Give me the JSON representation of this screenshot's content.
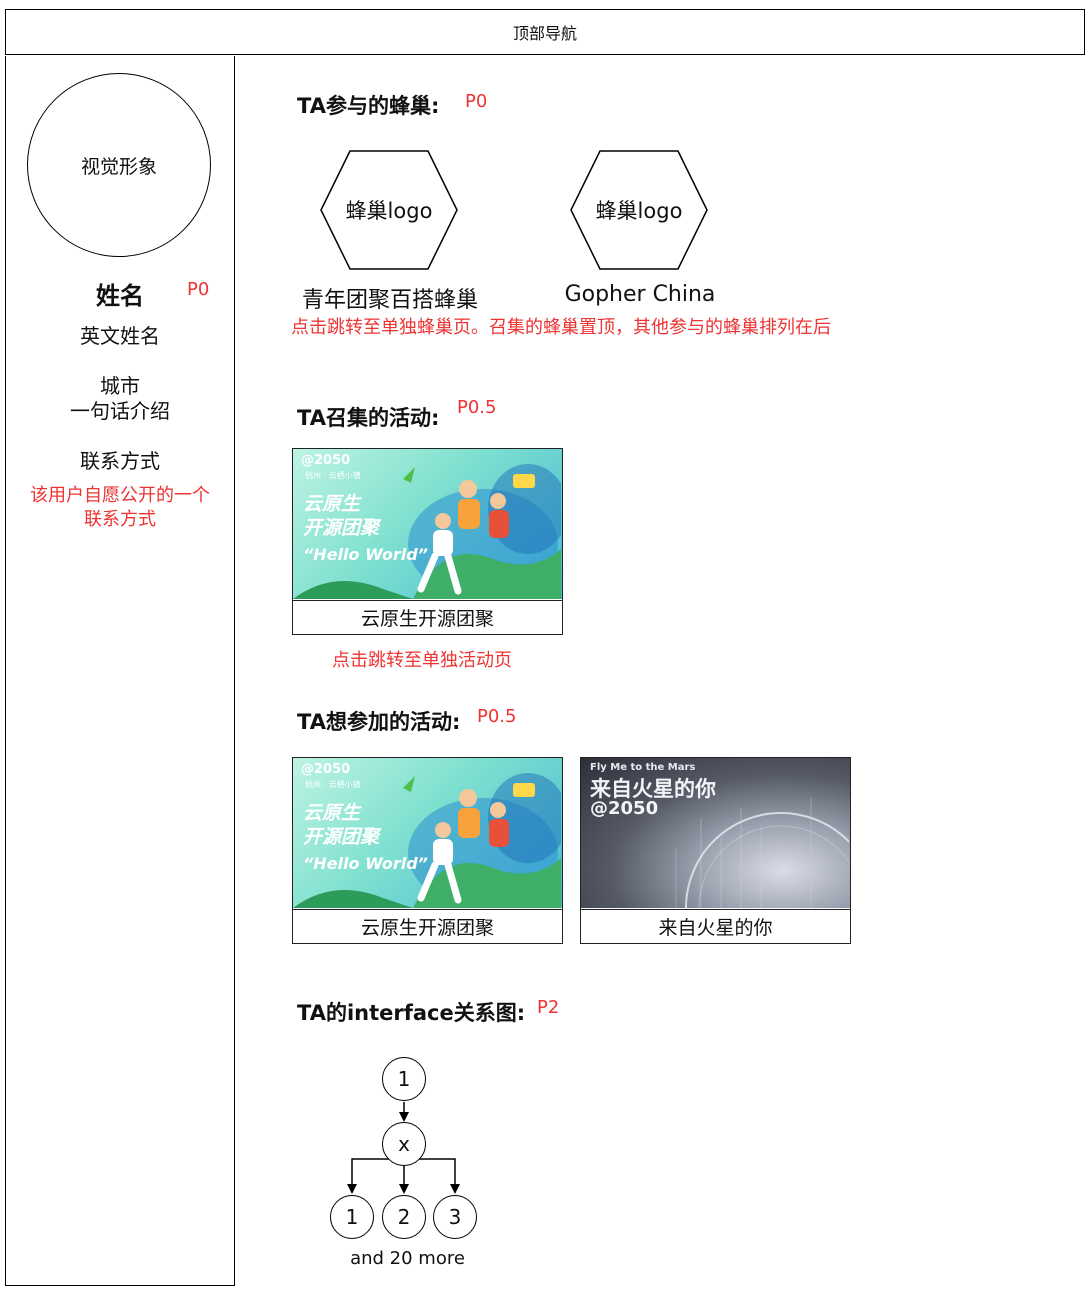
{
  "nav": {
    "title": "顶部导航"
  },
  "sidebar": {
    "avatar_text": "视觉形象",
    "name": "姓名",
    "name_priority": "P0",
    "english_name": "英文姓名",
    "city": "城市",
    "intro": "一句话介绍",
    "contact": "联系方式",
    "contact_note_line1": "该用户自愿公开的一个",
    "contact_note_line2": "联系方式"
  },
  "hives": {
    "title": "TA参与的蜂巢:",
    "priority": "P0",
    "items": [
      {
        "logo": "蜂巢logo",
        "name": "青年团聚百搭蜂巢"
      },
      {
        "logo": "蜂巢logo",
        "name": "Gopher China"
      }
    ],
    "note": "点击跳转至单独蜂巢页。召集的蜂巢置顶，其他参与的蜂巢排列在后"
  },
  "hosted": {
    "title": "TA召集的活动:",
    "priority": "P0.5",
    "items": [
      {
        "caption": "云原生开源团聚",
        "poster_brand": "@2050",
        "poster_sub": "杭州 · 云栖小镇",
        "poster_line1": "云原生",
        "poster_line2": "开源团聚",
        "poster_tagline": "“Hello World”"
      }
    ],
    "note": "点击跳转至单独活动页"
  },
  "wanted": {
    "title": "TA想参加的活动:",
    "priority": "P0.5",
    "items": [
      {
        "caption": "云原生开源团聚",
        "poster_brand": "@2050",
        "poster_sub": "杭州 · 云栖小镇",
        "poster_line1": "云原生",
        "poster_line2": "开源团聚",
        "poster_tagline": "“Hello World”"
      },
      {
        "caption": "来自火星的你",
        "poster_small": "Fly Me to the Mars",
        "poster_line1": "来自火星的你",
        "poster_line2": "@2050"
      }
    ]
  },
  "graph": {
    "title": "TA的interface关系图:",
    "priority": "P2",
    "root": "1",
    "middle": "x",
    "children": [
      "1",
      "2",
      "3"
    ],
    "more": "and 20 more"
  },
  "colors": {
    "note_red": "#ee3333",
    "border": "#000000"
  }
}
